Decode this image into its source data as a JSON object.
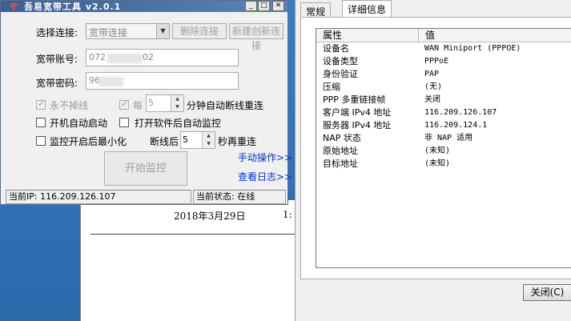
{
  "app": {
    "title": "吾易宽带工具 v2.0.1",
    "select_label": "选择连接:",
    "select_value": "宽带连接",
    "delete_button": "删除连接",
    "new_button": "新建创新连接",
    "account_label": "宽带账号:",
    "account_value": "072",
    "account_value_tail": "02",
    "password_label": "宽带密码:",
    "password_value": "96",
    "never_drop": "永不掉线",
    "every_label": "每",
    "every_value": "5",
    "every_suffix": "分钟自动断线重连",
    "auto_start": "开机自动启动",
    "auto_monitor": "打开软件后自动监控",
    "minimize": "监控开启后最小化",
    "retry_prefix": "断线后",
    "retry_value": "5",
    "retry_suffix": "秒再重连",
    "manual_link": "手动操作>>",
    "log_link": "查看日志>>",
    "start_button": "开始监控",
    "status_ip": "当前IP: 116.209.126.107",
    "status_state": "当前状态: 在线"
  },
  "document": {
    "date": "2018年3月29日",
    "time": "1:"
  },
  "properties": {
    "tabs": [
      "常规",
      "详细信息"
    ],
    "col_property": "属性",
    "col_value": "值",
    "rows": [
      {
        "name": "设备名",
        "value": "WAN Miniport (PPPOE)"
      },
      {
        "name": "设备类型",
        "value": "PPPoE"
      },
      {
        "name": "身份验证",
        "value": "PAP"
      },
      {
        "name": "压缩",
        "value": "(无)"
      },
      {
        "name": "PPP 多重链接帧",
        "value": "关闭"
      },
      {
        "name": "客户端 IPv4 地址",
        "value": "116.209.126.107"
      },
      {
        "name": "服务器 IPv4 地址",
        "value": "116.209.124.1"
      },
      {
        "name": "NAP 状态",
        "value": "非 NAP 适用"
      },
      {
        "name": "原始地址",
        "value": "(未知)"
      },
      {
        "name": "目标地址",
        "value": "(未知)"
      }
    ],
    "close_button": "关闭(C)"
  }
}
